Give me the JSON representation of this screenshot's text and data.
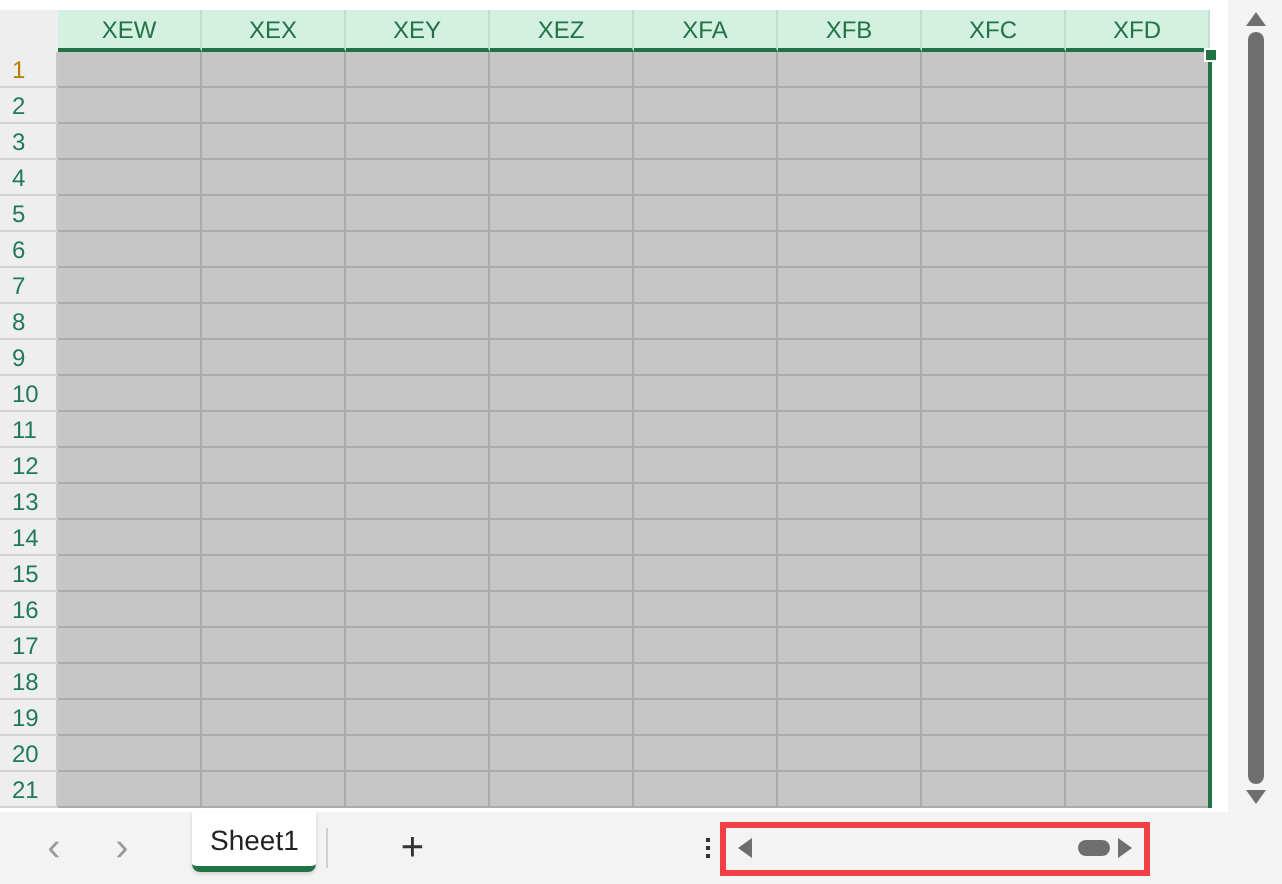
{
  "columns": [
    "XEW",
    "XEX",
    "XEY",
    "XEZ",
    "XFA",
    "XFB",
    "XFC",
    "XFD"
  ],
  "rows": [
    "1",
    "2",
    "3",
    "4",
    "5",
    "6",
    "7",
    "8",
    "9",
    "10",
    "11",
    "12",
    "13",
    "14",
    "15",
    "16",
    "17",
    "18",
    "19",
    "20",
    "21"
  ],
  "selection": {
    "whole_area": true
  },
  "sheet_nav": {
    "prev": "‹",
    "next": "›"
  },
  "sheet_tabs": [
    {
      "label": "Sheet1",
      "selected": true
    }
  ],
  "add_sheet": "+",
  "horizontal_scrollbar": {
    "highlighted": true
  }
}
